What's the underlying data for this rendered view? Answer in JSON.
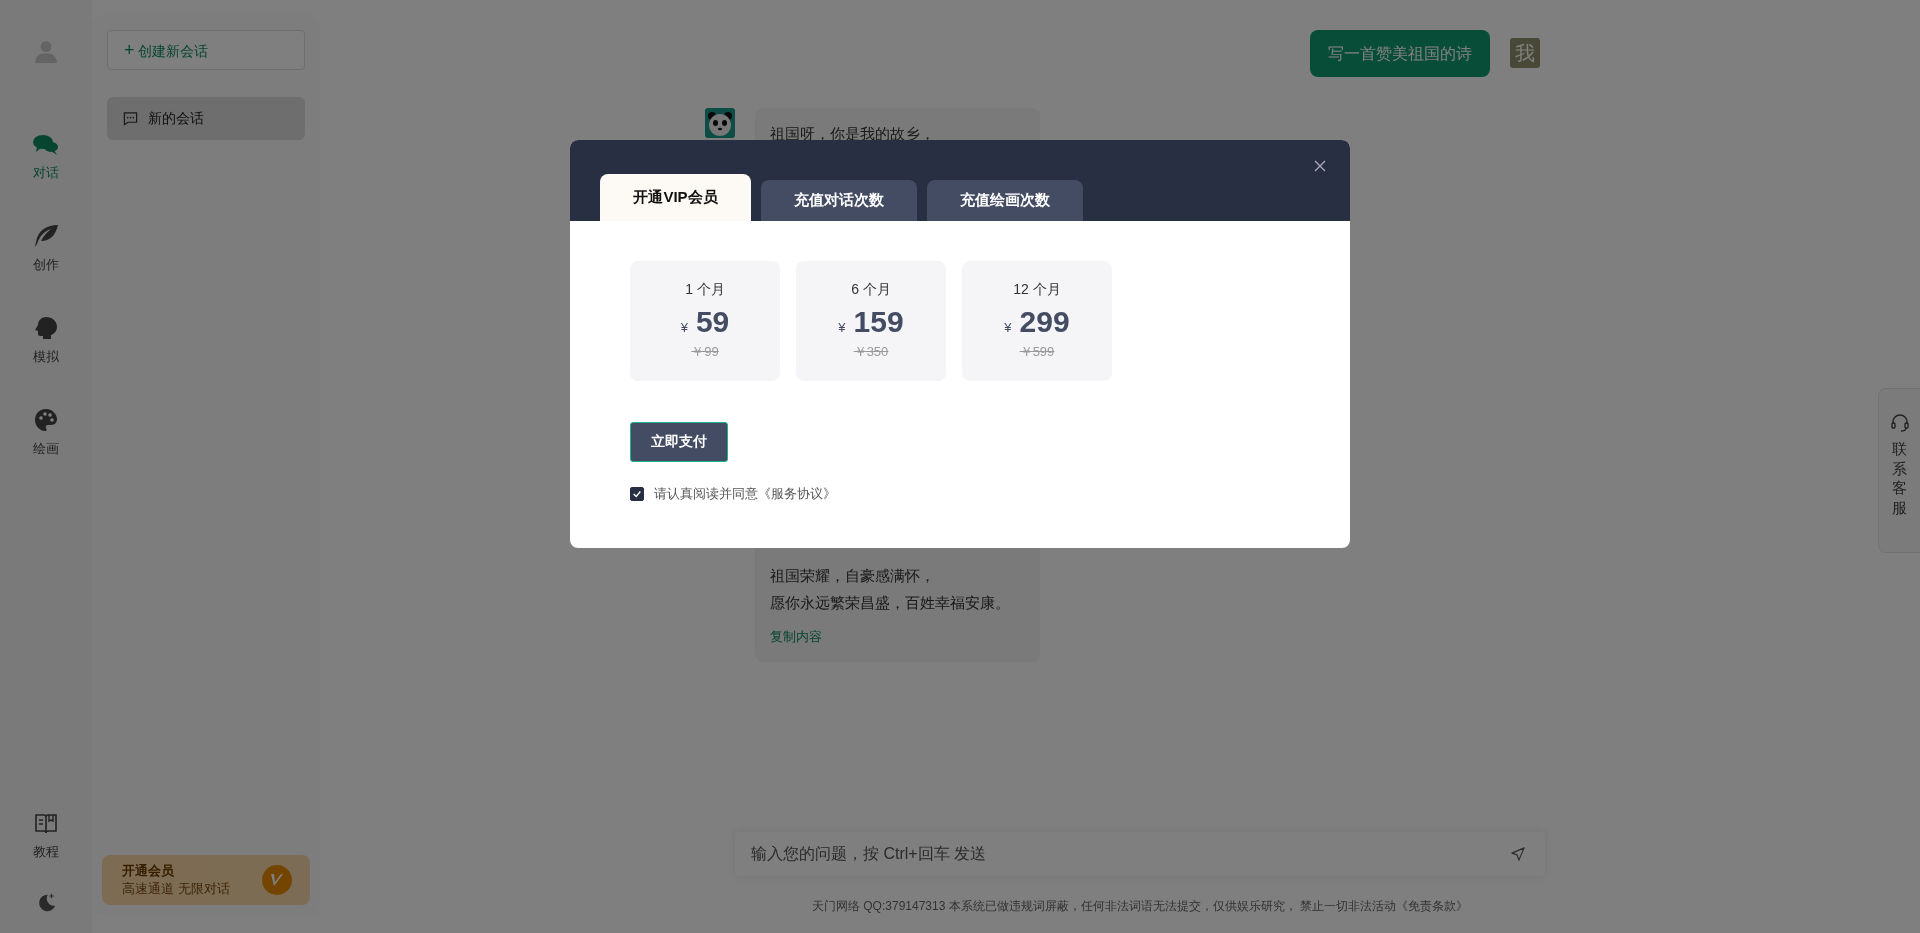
{
  "nav": {
    "items": [
      {
        "label": "对话",
        "selected": true
      },
      {
        "label": "创作",
        "selected": false
      },
      {
        "label": "模拟",
        "selected": false
      },
      {
        "label": "绘画",
        "selected": false
      }
    ],
    "bottom_items": [
      {
        "label": "教程"
      }
    ]
  },
  "sidebar": {
    "new_button": {
      "icon": "+",
      "label": "创建新会话"
    },
    "conversations": [
      {
        "title": "新的会话",
        "selected": true
      }
    ],
    "promo": {
      "title": "开通会员",
      "subtitle": "高速通道 无限对话"
    }
  },
  "chat": {
    "messages": [
      {
        "kind": "user",
        "text": "写一首赞美祖国的诗",
        "avatar": "我"
      },
      {
        "kind": "bot",
        "lines_top": [
          "祖国呀，你是我的故乡，"
        ],
        "lines_bottom": [
          "祖国荣耀，自豪感满怀，",
          "愿你永远繁荣昌盛，百姓幸福安康。"
        ],
        "action": "复制内容"
      }
    ],
    "input": {
      "placeholder": "输入您的问题，按 Ctrl+回车 发送"
    },
    "footer": "天门网络 QQ:379147313 本系统已做违规词屏蔽，任何非法词语无法提交，仅供娱乐研究， 禁止一切非法活动《免责条款》"
  },
  "contact_tab": {
    "label": "联系客服"
  },
  "modal": {
    "tabs": [
      {
        "label": "开通VIP会员",
        "selected": true
      },
      {
        "label": "充值对话次数",
        "selected": false
      },
      {
        "label": "充值绘画次数",
        "selected": false
      }
    ],
    "plans": [
      {
        "period": "1 个月",
        "currency": "¥",
        "price": "59",
        "original": "￥99"
      },
      {
        "period": "6 个月",
        "currency": "¥",
        "price": "159",
        "original": "￥350"
      },
      {
        "period": "12 个月",
        "currency": "¥",
        "price": "299",
        "original": "￥599"
      }
    ],
    "pay_button": "立即支付",
    "agreement": {
      "checked": true,
      "text": "请认真阅读并同意《服务协议》"
    }
  }
}
